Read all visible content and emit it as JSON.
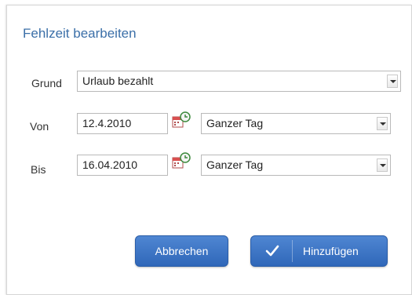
{
  "dialog": {
    "title": "Fehlzeit bearbeiten",
    "accent_color": "#3b6fa8",
    "button_color": "#3a72c2"
  },
  "form": {
    "grund": {
      "label": "Grund",
      "value": "Urlaub bezahlt"
    },
    "von": {
      "label": "Von",
      "date": "12.4.2010",
      "period": "Ganzer Tag"
    },
    "bis": {
      "label": "Bis",
      "date": "16.04.2010",
      "period": "Ganzer Tag"
    }
  },
  "buttons": {
    "cancel_label": "Abbrechen",
    "add_label": "Hinzufügen",
    "add_icon": "check-icon"
  },
  "icons": {
    "calendar": "calendar-icon",
    "dropdown": "chevron-down-icon"
  }
}
